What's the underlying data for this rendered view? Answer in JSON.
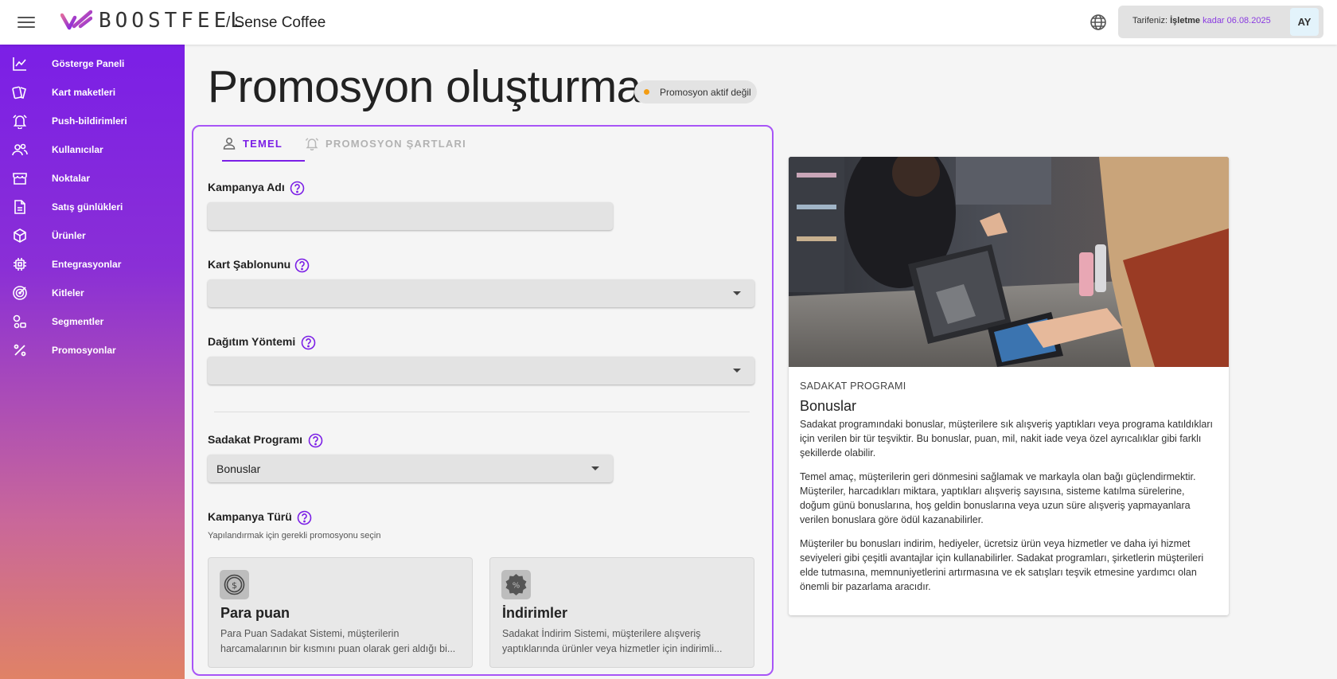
{
  "header": {
    "brand": "BOOSTFEEL",
    "breadcrumb": "/ Sense Coffee",
    "plan_prefix": "Tarifeniz:",
    "plan_name": "İşletme",
    "plan_until": "kadar 06.08.2025",
    "avatar_initials": "AY",
    "accent_color": "#8a3be0"
  },
  "sidebar": {
    "items": [
      {
        "label": "Gösterge Paneli",
        "icon": "chart-line-icon"
      },
      {
        "label": "Kart maketleri",
        "icon": "cards-icon"
      },
      {
        "label": "Push-bildirimleri",
        "icon": "bell-icon"
      },
      {
        "label": "Kullanıcılar",
        "icon": "users-icon"
      },
      {
        "label": "Noktalar",
        "icon": "store-icon"
      },
      {
        "label": "Satış günlükleri",
        "icon": "document-icon"
      },
      {
        "label": "Ürünler",
        "icon": "box-icon"
      },
      {
        "label": "Entegrasyonlar",
        "icon": "chip-icon"
      },
      {
        "label": "Kitleler",
        "icon": "target-icon"
      },
      {
        "label": "Segmentler",
        "icon": "segments-icon"
      },
      {
        "label": "Promosyonlar",
        "icon": "percent-icon"
      }
    ]
  },
  "page": {
    "title": "Promosyon oluşturma",
    "status": "Promosyon aktif değil",
    "status_color": "#f39c12"
  },
  "tabs": [
    {
      "label": "TEMEL",
      "active": true
    },
    {
      "label": "PROMOSYON ŞARTLARI",
      "active": false
    }
  ],
  "form": {
    "campaign_name": {
      "label": "Kampanya Adı",
      "value": ""
    },
    "card_template": {
      "label": "Kart Şablonunu",
      "value": ""
    },
    "distribution": {
      "label": "Dağıtım Yöntemi",
      "value": ""
    },
    "loyalty": {
      "label": "Sadakat Programı",
      "value": "Bonuslar"
    },
    "campaign_type": {
      "label": "Kampanya Türü",
      "hint": "Yapılandırmak için gerekli promosyonu seçin"
    },
    "types": [
      {
        "title": "Para puan",
        "desc": "Para Puan Sadakat Sistemi, müşterilerin harcamalarının bir kısmını puan olarak geri aldığı bi...",
        "icon": "coin-icon"
      },
      {
        "title": "İndirimler",
        "desc": "Sadakat İndirim Sistemi, müşterilere alışveriş yaptıklarında ürünler veya hizmetler için indirimli...",
        "icon": "discount-badge-icon"
      }
    ]
  },
  "info": {
    "overline": "SADAKAT PROGRAMI",
    "title": "Bonuslar",
    "paragraphs": [
      "Sadakat programındaki bonuslar, müşterilere sık alışveriş yaptıkları veya programa katıldıkları için verilen bir tür teşviktir. Bu bonuslar, puan, mil, nakit iade veya özel ayrıcalıklar gibi farklı şekillerde olabilir.",
      "Temel amaç, müşterilerin geri dönmesini sağlamak ve markayla olan bağı güçlendirmektir. Müşteriler, harcadıkları miktara, yaptıkları alışveriş sayısına, sisteme katılma sürelerine, doğum günü bonuslarına, hoş geldin bonuslarına veya uzun süre alışveriş yapmayanlara verilen bonuslara göre ödül kazanabilirler.",
      "Müşteriler bu bonusları indirim, hediyeler, ücretsiz ürün veya hizmetler ve daha iyi hizmet seviyeleri gibi çeşitli avantajlar için kullanabilirler. Sadakat programları, şirketlerin müşterileri elde tutmasına, memnuniyetlerini artırmasına ve ek satışları teşvik etmesine yardımcı olan önemli bir pazarlama aracıdır."
    ]
  }
}
